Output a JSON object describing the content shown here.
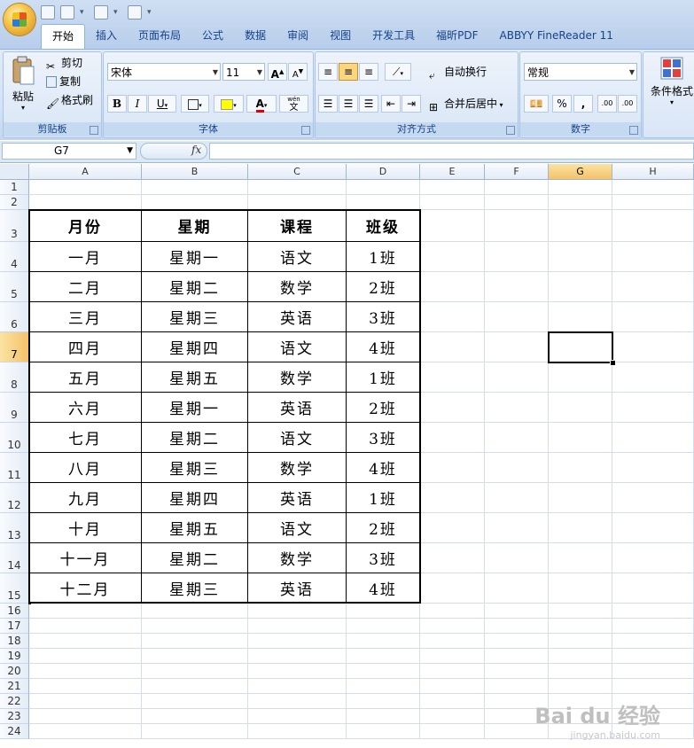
{
  "app": {
    "qat": [
      "save-icon",
      "undo-icon",
      "redo-icon",
      "print-preview-icon",
      "customize-icon"
    ]
  },
  "tabs": [
    {
      "label": "开始",
      "active": true
    },
    {
      "label": "插入"
    },
    {
      "label": "页面布局"
    },
    {
      "label": "公式"
    },
    {
      "label": "数据"
    },
    {
      "label": "审阅"
    },
    {
      "label": "视图"
    },
    {
      "label": "开发工具"
    },
    {
      "label": "福昕PDF"
    },
    {
      "label": "ABBYY FineReader 11"
    }
  ],
  "ribbon": {
    "clipboard": {
      "label": "剪贴板",
      "paste": "粘贴",
      "cut": "剪切",
      "copy": "复制",
      "format_painter": "格式刷"
    },
    "font": {
      "label": "字体",
      "font_name": "宋体",
      "font_size": "11",
      "bold": "B",
      "italic": "I",
      "underline": "U",
      "wen": "wén",
      "wen_char": "文"
    },
    "alignment": {
      "label": "对齐方式",
      "wrap_text": "自动换行",
      "merge_center": "合并后居中"
    },
    "number": {
      "label": "数字",
      "format": "常规",
      "percent": "%",
      "comma": ",",
      "inc_decimal": ".00",
      "dec_decimal": ".00"
    },
    "styles": {
      "conditional_format": "条件格式"
    }
  },
  "formula_bar": {
    "name_box": "G7",
    "fx": "fx",
    "content": ""
  },
  "grid": {
    "columns": [
      "A",
      "B",
      "C",
      "D",
      "E",
      "F",
      "G",
      "H"
    ],
    "rows": [
      "1",
      "2",
      "3",
      "4",
      "5",
      "6",
      "7",
      "8",
      "9",
      "10",
      "11",
      "12",
      "13",
      "14",
      "15",
      "16",
      "17",
      "18",
      "19",
      "20",
      "21",
      "22",
      "23",
      "24"
    ],
    "selected_col": "G",
    "selected_row": "7"
  },
  "table": {
    "headers": [
      "月份",
      "星期",
      "课程",
      "班级"
    ],
    "rows": [
      [
        "一月",
        "星期一",
        "语文",
        "1班"
      ],
      [
        "二月",
        "星期二",
        "数学",
        "2班"
      ],
      [
        "三月",
        "星期三",
        "英语",
        "3班"
      ],
      [
        "四月",
        "星期四",
        "语文",
        "4班"
      ],
      [
        "五月",
        "星期五",
        "数学",
        "1班"
      ],
      [
        "六月",
        "星期一",
        "英语",
        "2班"
      ],
      [
        "七月",
        "星期二",
        "语文",
        "3班"
      ],
      [
        "八月",
        "星期三",
        "数学",
        "4班"
      ],
      [
        "九月",
        "星期四",
        "英语",
        "1班"
      ],
      [
        "十月",
        "星期五",
        "语文",
        "2班"
      ],
      [
        "十一月",
        "星期二",
        "数学",
        "3班"
      ],
      [
        "十二月",
        "星期三",
        "英语",
        "4班"
      ]
    ]
  },
  "watermark": {
    "text": "Bai du 经验",
    "sub": "jingyan.baidu.com"
  }
}
